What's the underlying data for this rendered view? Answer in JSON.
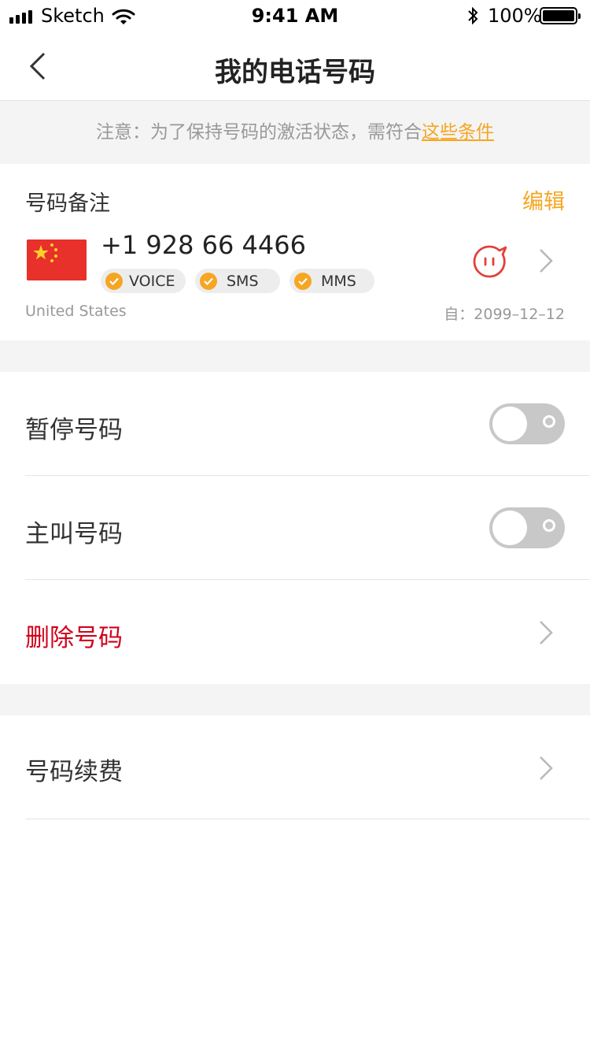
{
  "status_bar": {
    "carrier": "Sketch",
    "time": "9:41 AM",
    "battery": "100%"
  },
  "nav": {
    "title": "我的电话号码"
  },
  "notice": {
    "text": "注意：为了保持号码的激活状态，需符合",
    "link": "这些条件"
  },
  "number_card": {
    "title": "号码备注",
    "edit_label": "编辑",
    "phone": "+1 928 66 4466",
    "services": [
      "VOICE",
      "SMS",
      "MMS"
    ],
    "country": "United States",
    "since": "自：2099–12–12"
  },
  "settings": {
    "pause": {
      "label": "暂停号码",
      "on": false
    },
    "primary": {
      "label": "主叫号码",
      "on": false
    },
    "delete": {
      "label": "删除号码"
    },
    "renew": {
      "label": "号码续费"
    }
  },
  "colors": {
    "accent": "#f5a623",
    "danger": "#d0021b",
    "background_gap": "#f4f4f4",
    "toggle_off": "#c8c8c8"
  }
}
